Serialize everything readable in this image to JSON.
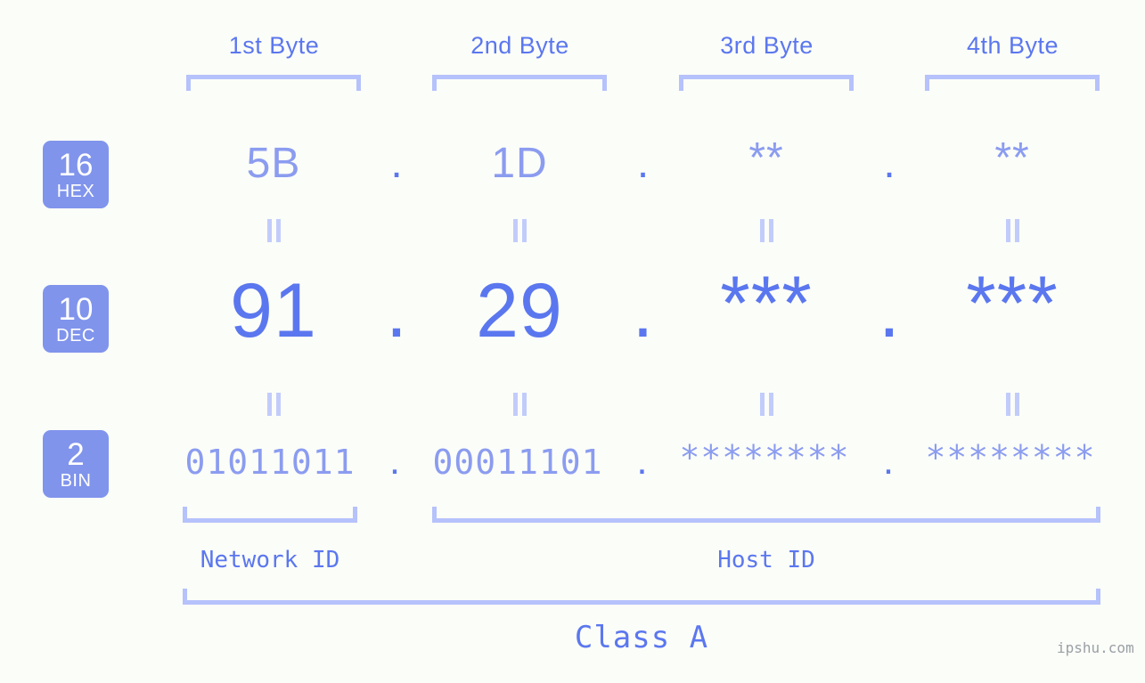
{
  "meta": {
    "background": "#fbfdf8",
    "accent_strong": "#5b77ef",
    "accent_light": "#8b9cf0",
    "bracket_color": "#b6c2fb",
    "badge_bg": "#8094ec"
  },
  "columns": [
    {
      "header": "1st Byte"
    },
    {
      "header": "2nd Byte"
    },
    {
      "header": "3rd Byte"
    },
    {
      "header": "4th Byte"
    }
  ],
  "rows": [
    {
      "badge_num": "16",
      "badge_name": "HEX",
      "values": [
        "5B",
        "1D",
        "**",
        "**"
      ]
    },
    {
      "badge_num": "10",
      "badge_name": "DEC",
      "values": [
        "91",
        "29",
        "***",
        "***"
      ]
    },
    {
      "badge_num": "2",
      "badge_name": "BIN",
      "values": [
        "01011011",
        "00011101",
        "********",
        "********"
      ]
    }
  ],
  "separators": {
    "dot": ".",
    "equals": "="
  },
  "segments": {
    "network_id": "Network ID",
    "host_id": "Host ID",
    "class": "Class A"
  },
  "watermark": "ipshu.com"
}
